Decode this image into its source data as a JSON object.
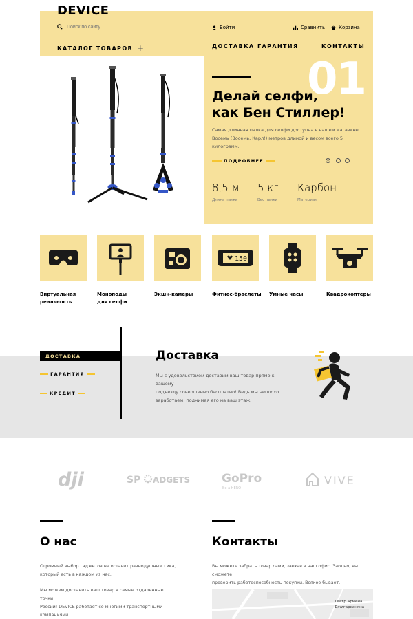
{
  "header": {
    "logo": "DEVICE",
    "search_placeholder": "Поиск по сайту",
    "login": "Войти",
    "compare": "Сравнить",
    "cart": "Корзина",
    "catalog": "КАТАЛОГ ТОВАРОВ",
    "nav": [
      "ДОСТАВКА",
      "ГАРАНТИЯ",
      "КОНТАКТЫ"
    ]
  },
  "slider": {
    "number": "01",
    "title_line1": "Делай селфи,",
    "title_line2": "как Бен Стиллер!",
    "text_line1": "Самая длинная палка для селфи доступна в нашем магазине.",
    "text_line2": "Восемь (Восемь, Карл!) метров длиной и весом всего 5 килограмм.",
    "more_button": "ПОДРОБНЕЕ",
    "specs": [
      {
        "value": "8,5 м",
        "label": "Длина палки"
      },
      {
        "value": "5 кг",
        "label": "Вес палки"
      },
      {
        "value": "Карбон",
        "label": "Материал"
      }
    ]
  },
  "categories": [
    {
      "line1": "Виртуальная",
      "line2": "реальность",
      "icon": "vr-headset-icon"
    },
    {
      "line1": "Моноподы",
      "line2": "для селфи",
      "icon": "monopod-icon"
    },
    {
      "line1": "Экшн-камеры",
      "line2": "",
      "icon": "action-camera-icon"
    },
    {
      "line1": "Фитнес-браслеты",
      "line2": "",
      "icon": "fitness-band-icon"
    },
    {
      "line1": "Умные часы",
      "line2": "",
      "icon": "smartwatch-icon"
    },
    {
      "line1": "Квадрокоптеры",
      "line2": "",
      "icon": "drone-icon"
    }
  ],
  "fitness_display": "150",
  "services": {
    "tabs": [
      "ДОСТАВКА",
      "ГАРАНТИЯ",
      "КРЕДИТ"
    ],
    "title": "Доставка",
    "text_lines": [
      "Мы с удовольствием доставим ваш товар прямо к вашему",
      "подъезду совершенно бесплатно! Ведь мы неплохо",
      "заработаем, поднимая его на ваш этаж."
    ]
  },
  "brands": {
    "dji": "dji",
    "sp_left": "SP",
    "sp_right": "ADGETS",
    "gopro": "GoPro",
    "gopro_sub": "Be a HERO",
    "vive": "VIVE"
  },
  "about": {
    "title": "О нас",
    "p1": [
      "Огромный выбор гаджетов не оставит равнодушным гика,",
      "который есть в каждом из нас."
    ],
    "p2": [
      "Мы можем доставить ваш товар в самые отдаленные точки",
      "России! DEVICE работает со многими транспортными компаниями."
    ]
  },
  "contacts": {
    "title": "Контакты",
    "p1": [
      "Вы можете забрать товар сами, заехав в наш офис. Заодно, вы сможете",
      "проверить работоспособность покупки. Всякое бывает."
    ],
    "map_label_1": "Театр Армена",
    "map_label_2": "Джигарханяна"
  },
  "colors": {
    "accent": "#f7e19b",
    "accent_strong": "#f5c531",
    "dark": "#000000",
    "band": "#e6e6e6"
  }
}
